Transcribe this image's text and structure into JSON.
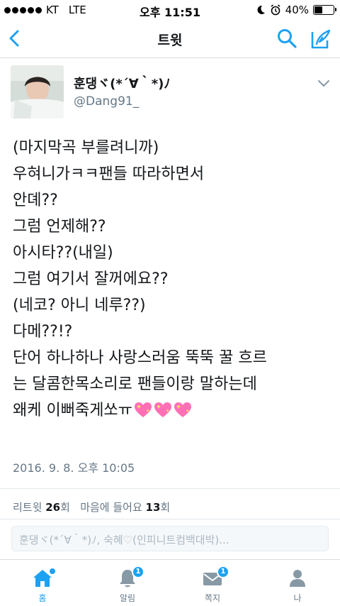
{
  "status_bar": {
    "carrier": "KT",
    "network": "LTE",
    "time": "오후 11:51",
    "battery": "40%",
    "battery_level": 0.4
  },
  "nav": {
    "title": "트윗"
  },
  "tweet": {
    "user_name": "훈댕ヾ(*´∀｀*)ﾉ",
    "user_handle": "@Dang91_",
    "lines": [
      "(마지막곡 부를려니까)",
      "우혀니가ㅋㅋ팬들 따라하면서",
      "안뎨??",
      "그럼 언제해??",
      "아시타??(내일)",
      "그럼 여기서 잘꺼에요??",
      "(네코? 아니 네루??)",
      "다메??!?",
      "단어 하나하나 사랑스러움 뚝뚝 꿀 흐르",
      "는 달콤한목소리로 팬들이랑 말하는데",
      "왜케 이뻐죽게쏘ㅠ"
    ],
    "timestamp": "2016. 9. 8. 오후 10:05",
    "stats": {
      "retweet_label": "리트윗",
      "retweet_count": "26",
      "retweet_unit": "회",
      "like_label": "마음에 들어요",
      "like_count": "13",
      "like_unit": "회"
    }
  },
  "reply": {
    "placeholder": "훈댕ヾ(*´∀｀*)ﾉ, 숙혜♡(인피니트컴백대박)..."
  },
  "tabs": [
    {
      "label": "홈",
      "icon": "home-icon",
      "active": true
    },
    {
      "label": "알림",
      "icon": "bell-icon",
      "badge": "1"
    },
    {
      "label": "쪽지",
      "icon": "envelope-icon",
      "badge": "1"
    },
    {
      "label": "나",
      "icon": "person-icon"
    }
  ],
  "colors": {
    "accent": "#1da1f2",
    "text": "#14171a",
    "muted": "#657786",
    "heart": "#ff6fb5"
  }
}
